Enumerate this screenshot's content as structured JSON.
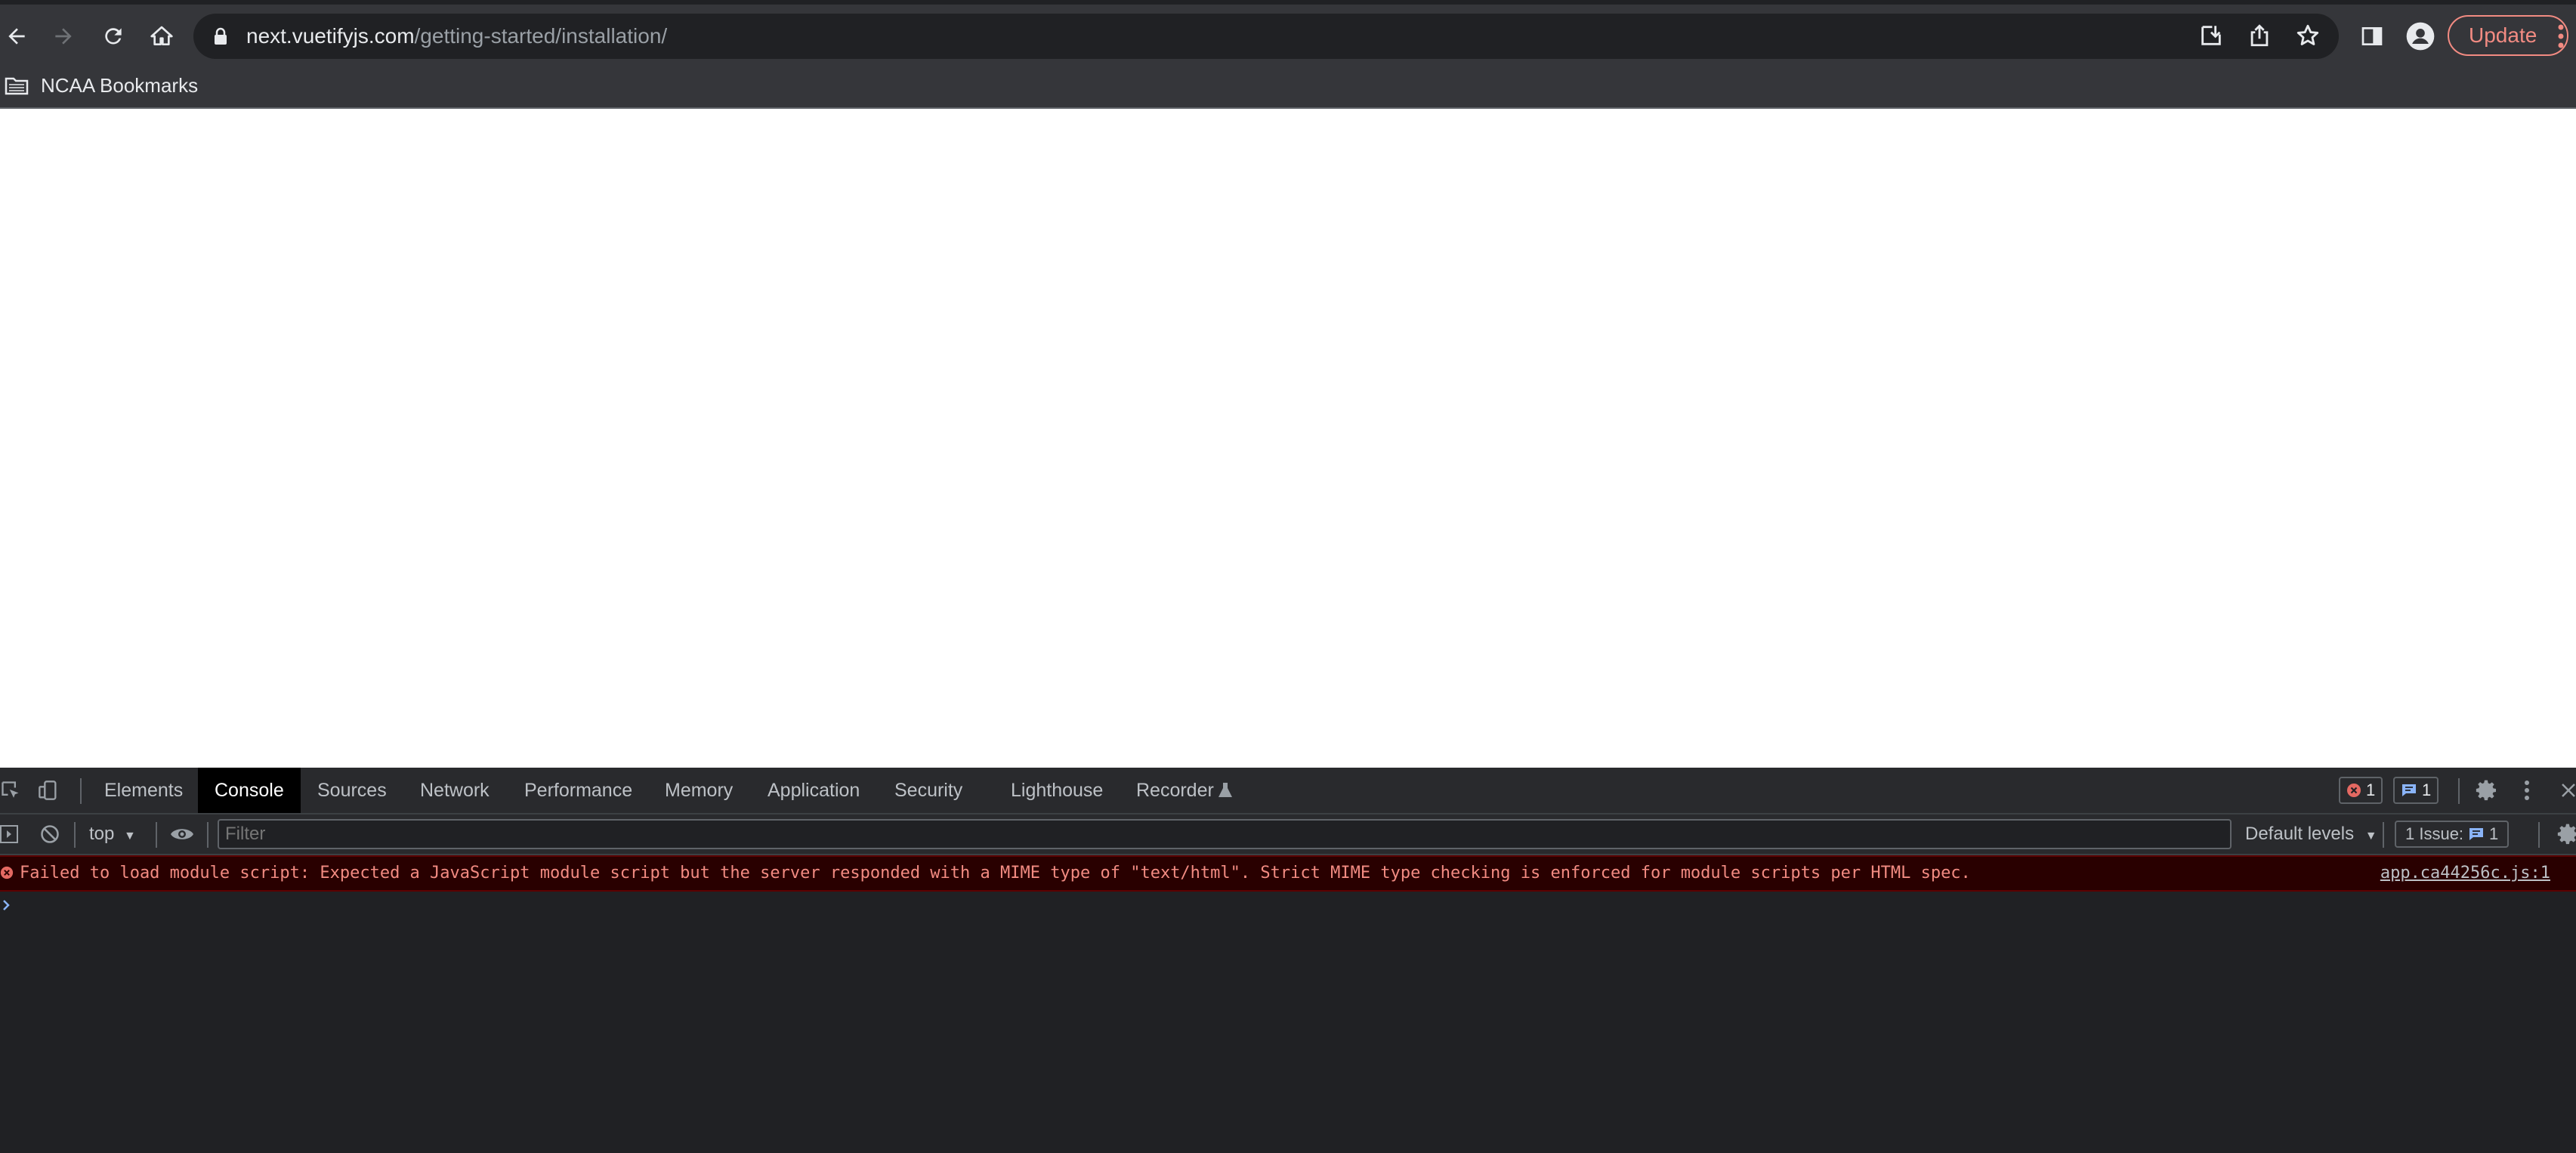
{
  "browser": {
    "url_host": "next.vuetifyjs.com",
    "url_path": "/getting-started/installation/",
    "update_label": "Update",
    "bookmark_label": "NCAA Bookmarks",
    "colors": {
      "accent": "#f28b82",
      "toolbar": "#35363a",
      "frame": "#202124"
    }
  },
  "devtools": {
    "tabs": [
      {
        "label": "Elements"
      },
      {
        "label": "Console",
        "active": true
      },
      {
        "label": "Sources"
      },
      {
        "label": "Network"
      },
      {
        "label": "Performance"
      },
      {
        "label": "Memory"
      },
      {
        "label": "Application"
      },
      {
        "label": "Security"
      },
      {
        "label": "Lighthouse"
      },
      {
        "label": "Recorder"
      }
    ],
    "error_count": "1",
    "message_count": "1",
    "context": "top",
    "filter_placeholder": "Filter",
    "levels": "Default levels",
    "issues_label": "1 Issue:",
    "issues_count": "1",
    "console": {
      "error_text": "Failed to load module script: Expected a JavaScript module script but the server responded with a MIME type of \"text/html\". Strict MIME type checking is enforced for module scripts per HTML spec.",
      "error_source": "app.ca44256c.js:1"
    }
  }
}
